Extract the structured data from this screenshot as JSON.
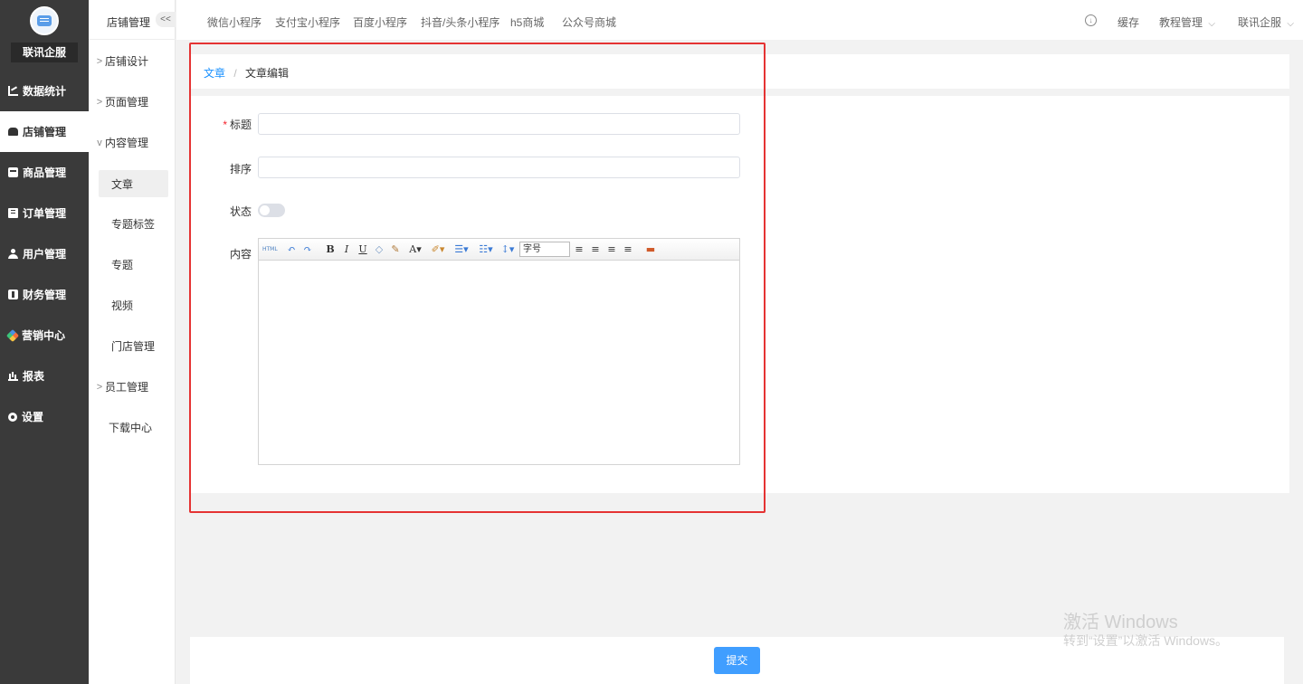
{
  "brand": "联讯企服",
  "main_nav": [
    {
      "label": "数据统计",
      "icon": "chart-icon"
    },
    {
      "label": "店铺管理",
      "icon": "shop-icon",
      "active": true
    },
    {
      "label": "商品管理",
      "icon": "goods-icon"
    },
    {
      "label": "订单管理",
      "icon": "order-icon"
    },
    {
      "label": "用户管理",
      "icon": "user-icon"
    },
    {
      "label": "财务管理",
      "icon": "finance-icon"
    },
    {
      "label": "营销中心",
      "icon": "marketing-icon"
    },
    {
      "label": "报表",
      "icon": "report-icon"
    },
    {
      "label": "设置",
      "icon": "settings-icon"
    }
  ],
  "sub_nav": {
    "title": "店铺管理",
    "collapse": "<<",
    "items": [
      {
        "label": "店铺设计",
        "arrow": ">"
      },
      {
        "label": "页面管理",
        "arrow": ">"
      },
      {
        "label": "内容管理",
        "arrow": "v"
      },
      {
        "label": "文章",
        "selected": true
      },
      {
        "label": "专题标签"
      },
      {
        "label": "专题"
      },
      {
        "label": "视频"
      },
      {
        "label": "门店管理"
      },
      {
        "label": "员工管理",
        "arrow": ">"
      },
      {
        "label": "下载中心"
      }
    ]
  },
  "top_nav": [
    "微信小程序",
    "支付宝小程序",
    "百度小程序",
    "抖音/头条小程序",
    "h5商城",
    "公众号商城"
  ],
  "top_right": {
    "cache": "缓存",
    "tutorial": "教程管理",
    "account": "联讯企服",
    "chevron": "⌵",
    "download": "↓"
  },
  "breadcrumb": {
    "link": "文章",
    "sep": "/",
    "current": "文章编辑"
  },
  "form": {
    "required_mark": "*",
    "title_label": "标题",
    "title_value": "",
    "sort_label": "排序",
    "sort_value": "",
    "status_label": "状态",
    "status_on": false,
    "content_label": "内容",
    "font_size": "字号"
  },
  "submit": "提交",
  "watermark": {
    "line1": "激活 Windows",
    "line2": "转到“设置”以激活 Windows。"
  },
  "colors": {
    "accent": "#409eff",
    "link": "#1890ff",
    "sidebar": "#3a3a3a",
    "annotation": "#e53333"
  }
}
